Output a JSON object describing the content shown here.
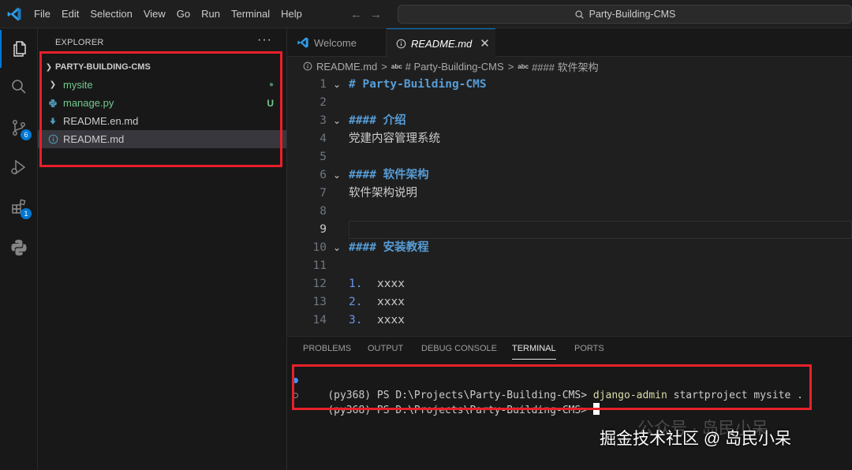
{
  "app": {
    "menu": [
      "File",
      "Edit",
      "Selection",
      "View",
      "Go",
      "Run",
      "Terminal",
      "Help"
    ],
    "search_text": "Party-Building-CMS"
  },
  "activity_bar": {
    "source_control_badge": "6",
    "extensions_badge": "1"
  },
  "explorer": {
    "title": "EXPLORER",
    "more": "···",
    "root": "PARTY-BUILDING-CMS",
    "items": [
      {
        "name": "mysite",
        "decoration": "●",
        "color": "#73c991"
      },
      {
        "name": "manage.py",
        "decoration": "U",
        "color": "#73c991"
      },
      {
        "name": "README.en.md",
        "decoration": "",
        "color": "#cccccc"
      },
      {
        "name": "README.md",
        "decoration": "",
        "color": "#cccccc"
      }
    ]
  },
  "tabs": [
    {
      "label": "Welcome"
    },
    {
      "label": "README.md",
      "close": "✕"
    }
  ],
  "breadcrumb": {
    "file": "README.md",
    "abc": "abc",
    "level1": "# Party-Building-CMS",
    "level2": "#### 软件架构"
  },
  "editor": {
    "lines": [
      {
        "n": "1",
        "text": "# Party-Building-CMS"
      },
      {
        "n": "2",
        "text": ""
      },
      {
        "n": "3",
        "text": "#### 介绍"
      },
      {
        "n": "4",
        "text": "党建内容管理系统"
      },
      {
        "n": "5",
        "text": ""
      },
      {
        "n": "6",
        "text": "#### 软件架构"
      },
      {
        "n": "7",
        "text": "软件架构说明"
      },
      {
        "n": "8",
        "text": ""
      },
      {
        "n": "9",
        "text": ""
      },
      {
        "n": "10",
        "text": "#### 安装教程"
      },
      {
        "n": "11",
        "text": ""
      },
      {
        "n": "12",
        "marker": "1.",
        "text": "xxxx"
      },
      {
        "n": "13",
        "marker": "2.",
        "text": "xxxx"
      },
      {
        "n": "14",
        "marker": "3.",
        "text": "xxxx"
      }
    ]
  },
  "panel": {
    "tabs": [
      "PROBLEMS",
      "OUTPUT",
      "DEBUG CONSOLE",
      "TERMINAL",
      "PORTS"
    ],
    "active_tab": "TERMINAL",
    "terminal": {
      "prompt": "(py368) PS D:\\Projects\\Party-Building-CMS>",
      "command": "django-admin",
      "args": "startproject mysite ."
    }
  },
  "watermark": {
    "text": "掘金技术社区 @ 岛民小呆",
    "ghost": "公众号 · 岛民小呆"
  }
}
